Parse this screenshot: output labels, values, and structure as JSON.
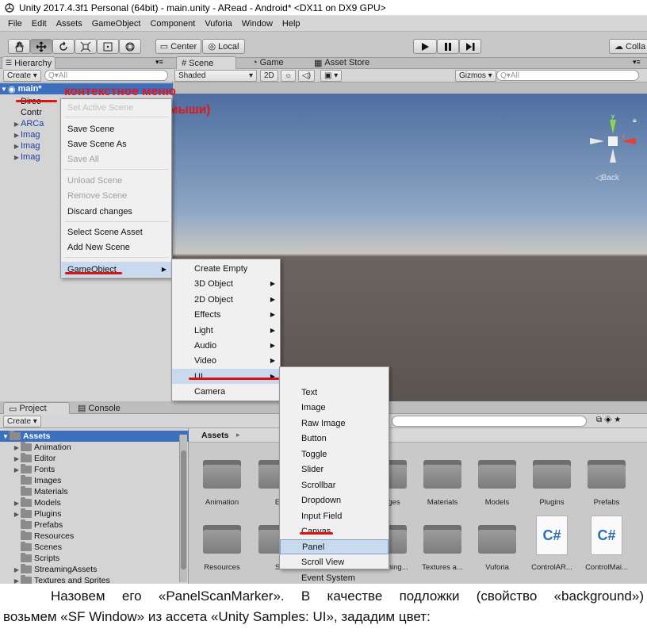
{
  "window": {
    "title": "Unity 2017.4.3f1 Personal (64bit) - main.unity - ARead - Android* <DX11 on DX9 GPU>"
  },
  "menubar": [
    "File",
    "Edit",
    "Assets",
    "GameObject",
    "Component",
    "Vuforia",
    "Window",
    "Help"
  ],
  "toolbar": {
    "center_label": "Center",
    "local_label": "Local",
    "collab_label": "Colla"
  },
  "hierarchy": {
    "tab_label": "Hierarchy",
    "create_label": "Create",
    "search_placeholder": "Q▾All",
    "items": [
      {
        "label": "main*",
        "selected": true
      },
      {
        "label": "Direc"
      },
      {
        "label": "Contr"
      },
      {
        "label": "ARCa"
      },
      {
        "label": "Imag"
      },
      {
        "label": "Imag"
      },
      {
        "label": "Imag"
      }
    ]
  },
  "scene": {
    "tabs": [
      "Scene",
      "Game",
      "Asset Store"
    ],
    "shaded_label": "Shaded",
    "mode_2d": "2D",
    "gizmos_label": "Gizmos",
    "search_placeholder": "Q▾All",
    "back_label": "Back"
  },
  "annotation": {
    "line1": "контекстное меню",
    "line2": "(правой кнопкой мыши)"
  },
  "context_menu": {
    "items": [
      {
        "label": "Set Active Scene",
        "disabled": true
      },
      {
        "label": "Save Scene"
      },
      {
        "label": "Save Scene As"
      },
      {
        "label": "Save All",
        "disabled": true
      },
      {
        "label": "Unload Scene",
        "disabled": true
      },
      {
        "label": "Remove Scene",
        "disabled": true
      },
      {
        "label": "Discard changes"
      },
      {
        "label": "Select Scene Asset"
      },
      {
        "label": "Add New Scene"
      },
      {
        "label": "GameObject",
        "submenu": true
      }
    ]
  },
  "gameobject_menu": {
    "items": [
      {
        "label": "Create Empty"
      },
      {
        "label": "3D Object",
        "submenu": true
      },
      {
        "label": "2D Object",
        "submenu": true
      },
      {
        "label": "Effects",
        "submenu": true
      },
      {
        "label": "Light",
        "submenu": true
      },
      {
        "label": "Audio",
        "submenu": true
      },
      {
        "label": "Video",
        "submenu": true
      },
      {
        "label": "UI",
        "submenu": true
      },
      {
        "label": "Camera"
      }
    ]
  },
  "ui_menu": {
    "items": [
      "Text",
      "Image",
      "Raw Image",
      "Button",
      "Toggle",
      "Slider",
      "Scrollbar",
      "Dropdown",
      "Input Field",
      "Canvas",
      "Panel",
      "Scroll View",
      "Event System"
    ]
  },
  "project": {
    "tabs": [
      "Project",
      "Console"
    ],
    "create_label": "Create",
    "breadcrumb": "Assets",
    "tree": [
      {
        "label": "Assets",
        "level": 0,
        "selected": true
      },
      {
        "label": "Animation",
        "level": 1,
        "arrow": true
      },
      {
        "label": "Editor",
        "level": 1,
        "arrow": true
      },
      {
        "label": "Fonts",
        "level": 1,
        "arrow": true
      },
      {
        "label": "Images",
        "level": 1
      },
      {
        "label": "Materials",
        "level": 1
      },
      {
        "label": "Models",
        "level": 1,
        "arrow": true
      },
      {
        "label": "Plugins",
        "level": 1,
        "arrow": true
      },
      {
        "label": "Prefabs",
        "level": 1
      },
      {
        "label": "Resources",
        "level": 1
      },
      {
        "label": "Scenes",
        "level": 1
      },
      {
        "label": "Scripts",
        "level": 1
      },
      {
        "label": "StreamingAssets",
        "level": 1,
        "arrow": true
      },
      {
        "label": "Textures and Sprites",
        "level": 1,
        "arrow": true
      }
    ],
    "grid_row1": [
      "Animation",
      "E",
      "",
      "Images",
      "Materials",
      "Models",
      "Plugins",
      "Prefabs"
    ],
    "grid_row2": [
      "Resources",
      "S",
      "",
      "Streaming...",
      "Textures a...",
      "Vuforia",
      "ControlAR...",
      "ControlMai..."
    ]
  },
  "caption": {
    "line1": "Назовем его «PanelScanMarker». В качестве подложки (свойство «background»)",
    "line2": "возьмем «SF Window» из ассета «Unity Samples: UI», зададим цвет:"
  }
}
